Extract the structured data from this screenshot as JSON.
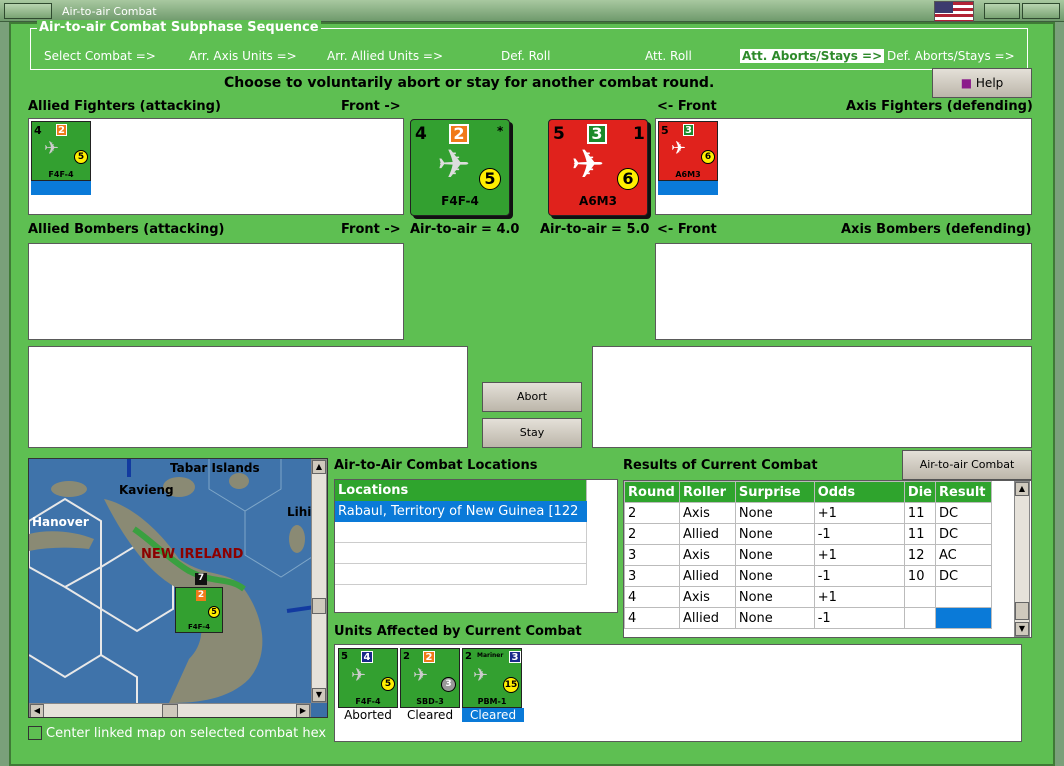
{
  "window": {
    "title": "Air-to-air Combat"
  },
  "phase": {
    "legend": "Air-to-air Combat Subphase Sequence",
    "items": [
      "Select Combat =>",
      "Arr. Axis Units =>",
      "Arr. Allied Units =>",
      "Def. Roll",
      "Att. Roll",
      "Att. Aborts/Stays =>",
      "Def. Aborts/Stays =>"
    ]
  },
  "instruction": "Choose to voluntarily abort or stay for another combat round.",
  "help_label": "Help",
  "labels": {
    "allied_fighters": "Allied Fighters (attacking)",
    "front_right": "Front ->",
    "front_left": "<- Front",
    "axis_fighters": "Axis Fighters (defending)",
    "allied_bombers": "Allied Bombers (attacking)",
    "axis_bombers": "Axis Bombers (defending)",
    "allied_a2a": "Air-to-air = 4.0",
    "axis_a2a": "Air-to-air = 5.0"
  },
  "allied_counter": {
    "name": "F4F-4",
    "left": "4",
    "badge": "2",
    "ring": "5",
    "star": "*"
  },
  "axis_counter": {
    "name": "A6M3",
    "left": "5",
    "badge": "3",
    "right": "1",
    "ring": "6",
    "star": "*"
  },
  "buttons": {
    "abort": "Abort",
    "stay": "Stay",
    "chart": "Air-to-air Combat Chart"
  },
  "map": {
    "labels": [
      "Tabar Islands",
      "Kavieng",
      "Hanover",
      "Lihi",
      "NEW IRELAND"
    ],
    "counter": {
      "name": "F4F-4",
      "badge": "2",
      "ring": "5",
      "stack": "7"
    }
  },
  "center_map_label": "Center linked map on selected combat hex",
  "locations": {
    "title": "Air-to-Air Combat Locations",
    "header": "Locations",
    "rows": [
      "Rabaul, Territory of New Guinea [122"
    ]
  },
  "results": {
    "title": "Results of Current Combat",
    "headers": [
      "Round",
      "Roller",
      "Surprise",
      "Odds",
      "Die",
      "Result"
    ],
    "rows": [
      [
        "2",
        "Axis",
        "None",
        "+1",
        "11",
        "DC"
      ],
      [
        "2",
        "Allied",
        "None",
        "-1",
        "11",
        "DC"
      ],
      [
        "3",
        "Axis",
        "None",
        "+1",
        "12",
        "AC"
      ],
      [
        "3",
        "Allied",
        "None",
        "-1",
        "10",
        "DC"
      ],
      [
        "4",
        "Axis",
        "None",
        "+1",
        "",
        ""
      ],
      [
        "4",
        "Allied",
        "None",
        "-1",
        "",
        ""
      ]
    ]
  },
  "affected": {
    "title": "Units Affected by Current Combat",
    "units": [
      {
        "name": "F4F-4",
        "left": "5",
        "badge": "4",
        "ring": "5",
        "status": "Aborted"
      },
      {
        "name": "SBD-3",
        "left": "2",
        "badge": "2",
        "ring": "3",
        "status": "Cleared"
      },
      {
        "name": "PBM-1",
        "left": "2",
        "badge": "3",
        "ring": "15",
        "top": "Mariner",
        "status": "Cleared"
      }
    ]
  }
}
